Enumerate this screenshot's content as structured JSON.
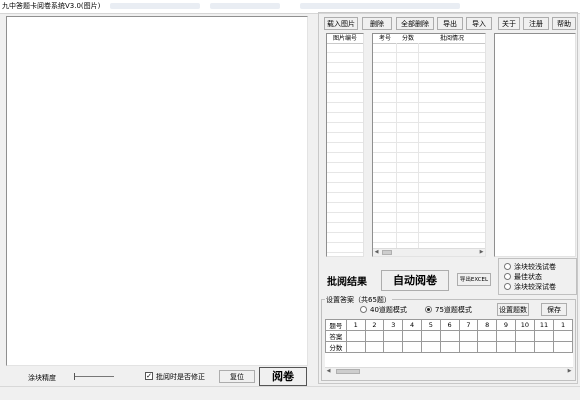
{
  "window": {
    "title": "九中答题卡阅卷系统V3.0(图片)"
  },
  "toolbar": {
    "load_images": "载入图片",
    "delete": "删除",
    "delete_all": "全部删除",
    "export": "导出",
    "import": "导入",
    "about": "关于",
    "register": "注册",
    "help": "帮助"
  },
  "image_list": {
    "header": "图片编号"
  },
  "results_table": {
    "headers": [
      "考号",
      "分数",
      "批阅情况"
    ]
  },
  "grading": {
    "title": "批阅结果",
    "auto_button": "自动阅卷",
    "export_excel": "导出EXCEL"
  },
  "modes": {
    "options": [
      "涂块较浅试卷",
      "最佳状态",
      "涂块较深试卷"
    ],
    "selected": null
  },
  "answer_setup": {
    "title": "设置答案（共65题）",
    "mode_40": "40道题模式",
    "mode_75": "75道题模式",
    "selected_mode": "75道题模式",
    "set_score_button": "设置题数",
    "save_button": "保存",
    "row_headers": [
      "题号",
      "答案",
      "分数"
    ],
    "question_numbers": [
      "1",
      "2",
      "3",
      "4",
      "5",
      "6",
      "7",
      "8",
      "9",
      "10",
      "11",
      "1"
    ]
  },
  "bottom": {
    "precision_label": "涂块精度",
    "correction_checkbox_label": "批阅时是否修正",
    "correction_checked": true,
    "reset_button": "复位",
    "grade_button": "阅卷"
  }
}
